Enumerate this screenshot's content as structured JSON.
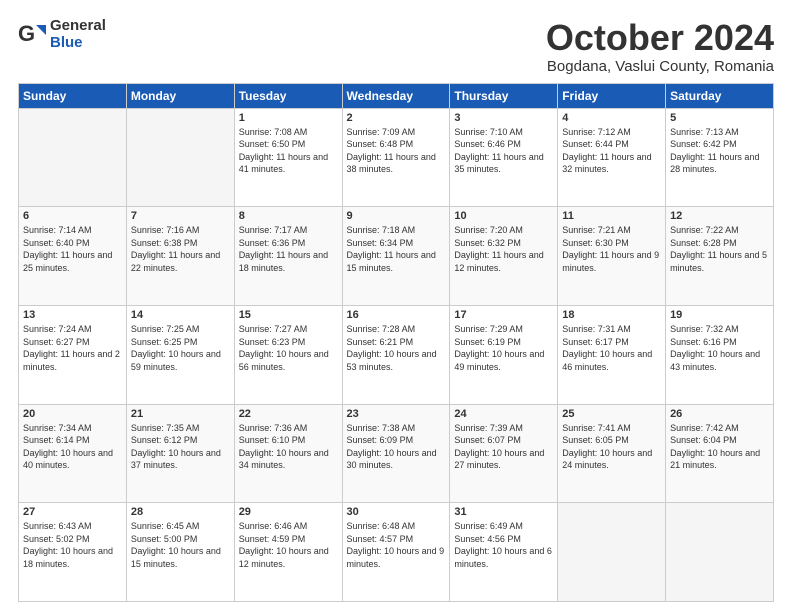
{
  "header": {
    "logo_general": "General",
    "logo_blue": "Blue",
    "title": "October 2024",
    "location": "Bogdana, Vaslui County, Romania"
  },
  "days_of_week": [
    "Sunday",
    "Monday",
    "Tuesday",
    "Wednesday",
    "Thursday",
    "Friday",
    "Saturday"
  ],
  "weeks": [
    [
      {
        "day": "",
        "info": ""
      },
      {
        "day": "",
        "info": ""
      },
      {
        "day": "1",
        "info": "Sunrise: 7:08 AM\nSunset: 6:50 PM\nDaylight: 11 hours and 41 minutes."
      },
      {
        "day": "2",
        "info": "Sunrise: 7:09 AM\nSunset: 6:48 PM\nDaylight: 11 hours and 38 minutes."
      },
      {
        "day": "3",
        "info": "Sunrise: 7:10 AM\nSunset: 6:46 PM\nDaylight: 11 hours and 35 minutes."
      },
      {
        "day": "4",
        "info": "Sunrise: 7:12 AM\nSunset: 6:44 PM\nDaylight: 11 hours and 32 minutes."
      },
      {
        "day": "5",
        "info": "Sunrise: 7:13 AM\nSunset: 6:42 PM\nDaylight: 11 hours and 28 minutes."
      }
    ],
    [
      {
        "day": "6",
        "info": "Sunrise: 7:14 AM\nSunset: 6:40 PM\nDaylight: 11 hours and 25 minutes."
      },
      {
        "day": "7",
        "info": "Sunrise: 7:16 AM\nSunset: 6:38 PM\nDaylight: 11 hours and 22 minutes."
      },
      {
        "day": "8",
        "info": "Sunrise: 7:17 AM\nSunset: 6:36 PM\nDaylight: 11 hours and 18 minutes."
      },
      {
        "day": "9",
        "info": "Sunrise: 7:18 AM\nSunset: 6:34 PM\nDaylight: 11 hours and 15 minutes."
      },
      {
        "day": "10",
        "info": "Sunrise: 7:20 AM\nSunset: 6:32 PM\nDaylight: 11 hours and 12 minutes."
      },
      {
        "day": "11",
        "info": "Sunrise: 7:21 AM\nSunset: 6:30 PM\nDaylight: 11 hours and 9 minutes."
      },
      {
        "day": "12",
        "info": "Sunrise: 7:22 AM\nSunset: 6:28 PM\nDaylight: 11 hours and 5 minutes."
      }
    ],
    [
      {
        "day": "13",
        "info": "Sunrise: 7:24 AM\nSunset: 6:27 PM\nDaylight: 11 hours and 2 minutes."
      },
      {
        "day": "14",
        "info": "Sunrise: 7:25 AM\nSunset: 6:25 PM\nDaylight: 10 hours and 59 minutes."
      },
      {
        "day": "15",
        "info": "Sunrise: 7:27 AM\nSunset: 6:23 PM\nDaylight: 10 hours and 56 minutes."
      },
      {
        "day": "16",
        "info": "Sunrise: 7:28 AM\nSunset: 6:21 PM\nDaylight: 10 hours and 53 minutes."
      },
      {
        "day": "17",
        "info": "Sunrise: 7:29 AM\nSunset: 6:19 PM\nDaylight: 10 hours and 49 minutes."
      },
      {
        "day": "18",
        "info": "Sunrise: 7:31 AM\nSunset: 6:17 PM\nDaylight: 10 hours and 46 minutes."
      },
      {
        "day": "19",
        "info": "Sunrise: 7:32 AM\nSunset: 6:16 PM\nDaylight: 10 hours and 43 minutes."
      }
    ],
    [
      {
        "day": "20",
        "info": "Sunrise: 7:34 AM\nSunset: 6:14 PM\nDaylight: 10 hours and 40 minutes."
      },
      {
        "day": "21",
        "info": "Sunrise: 7:35 AM\nSunset: 6:12 PM\nDaylight: 10 hours and 37 minutes."
      },
      {
        "day": "22",
        "info": "Sunrise: 7:36 AM\nSunset: 6:10 PM\nDaylight: 10 hours and 34 minutes."
      },
      {
        "day": "23",
        "info": "Sunrise: 7:38 AM\nSunset: 6:09 PM\nDaylight: 10 hours and 30 minutes."
      },
      {
        "day": "24",
        "info": "Sunrise: 7:39 AM\nSunset: 6:07 PM\nDaylight: 10 hours and 27 minutes."
      },
      {
        "day": "25",
        "info": "Sunrise: 7:41 AM\nSunset: 6:05 PM\nDaylight: 10 hours and 24 minutes."
      },
      {
        "day": "26",
        "info": "Sunrise: 7:42 AM\nSunset: 6:04 PM\nDaylight: 10 hours and 21 minutes."
      }
    ],
    [
      {
        "day": "27",
        "info": "Sunrise: 6:43 AM\nSunset: 5:02 PM\nDaylight: 10 hours and 18 minutes."
      },
      {
        "day": "28",
        "info": "Sunrise: 6:45 AM\nSunset: 5:00 PM\nDaylight: 10 hours and 15 minutes."
      },
      {
        "day": "29",
        "info": "Sunrise: 6:46 AM\nSunset: 4:59 PM\nDaylight: 10 hours and 12 minutes."
      },
      {
        "day": "30",
        "info": "Sunrise: 6:48 AM\nSunset: 4:57 PM\nDaylight: 10 hours and 9 minutes."
      },
      {
        "day": "31",
        "info": "Sunrise: 6:49 AM\nSunset: 4:56 PM\nDaylight: 10 hours and 6 minutes."
      },
      {
        "day": "",
        "info": ""
      },
      {
        "day": "",
        "info": ""
      }
    ]
  ]
}
